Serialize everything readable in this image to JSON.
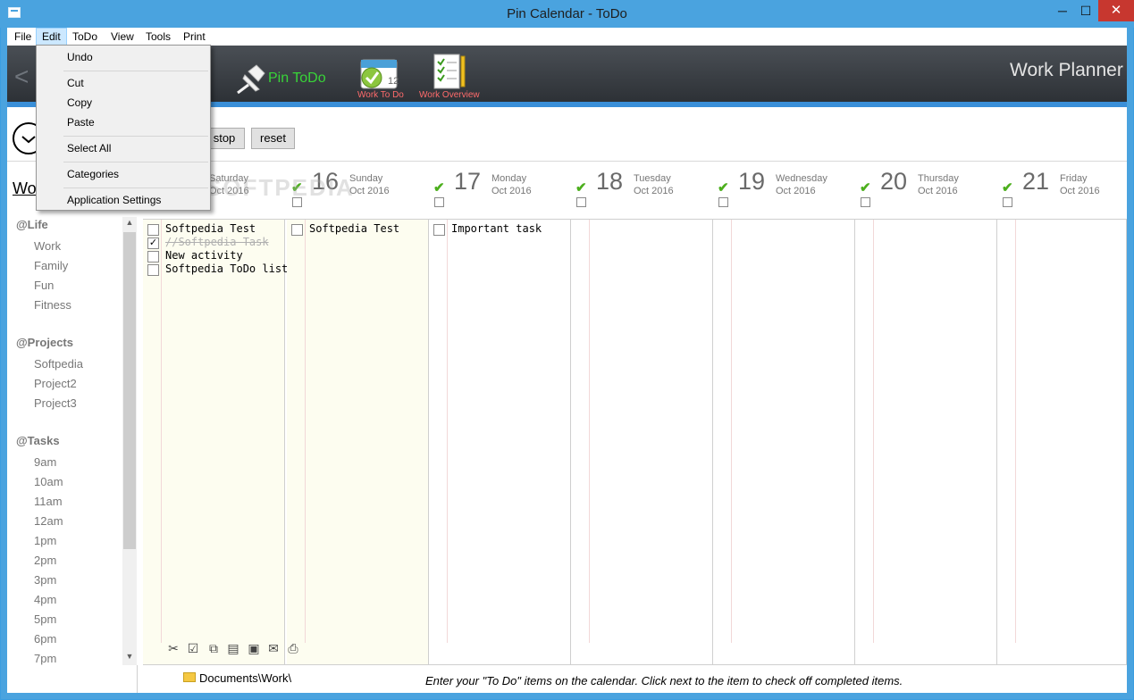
{
  "window": {
    "title": "Pin Calendar - ToDo",
    "minimize": "─",
    "maximize": "☐",
    "close": "✕"
  },
  "menubar": [
    "File",
    "Edit",
    "ToDo",
    "View",
    "Tools",
    "Print"
  ],
  "edit_menu": {
    "undo": "Undo",
    "cut": "Cut",
    "copy": "Copy",
    "paste": "Paste",
    "select_all": "Select All",
    "categories": "Categories",
    "application_settings": "Application Settings"
  },
  "toolbar": {
    "prev": "<",
    "pin_todo": "Pin ToDo",
    "work_todo": "Work To Do",
    "work_overview": "Work Overview",
    "planner_title": "Work Planner",
    "accent_color": "#3a8fd8"
  },
  "timer": {
    "stop": "stop",
    "reset": "reset"
  },
  "sidebar": {
    "title": "Wo",
    "groups": [
      {
        "head": "@Life",
        "items": [
          "Work",
          "Family",
          "Fun",
          "Fitness"
        ]
      },
      {
        "head": "@Projects",
        "items": [
          "Softpedia",
          "Project2",
          "Project3"
        ]
      },
      {
        "head": "@Tasks",
        "items": [
          "9am",
          "10am",
          "11am",
          "12am",
          "1pm",
          "2pm",
          "3pm",
          "4pm",
          "5pm",
          "6pm",
          "7pm"
        ]
      }
    ]
  },
  "calendar": {
    "days": [
      {
        "num": "",
        "name": "Saturday",
        "month": "Oct 2016",
        "tasks": [
          {
            "text": "Softpedia Test",
            "done": false
          },
          {
            "text": "//Softpedia Task",
            "done": true
          },
          {
            "text": "New activity",
            "done": false
          },
          {
            "text": "Softpedia ToDo list",
            "done": false
          }
        ]
      },
      {
        "num": "16",
        "name": "Sunday",
        "month": "Oct 2016",
        "tasks": [
          {
            "text": "Softpedia Test",
            "done": false
          }
        ]
      },
      {
        "num": "17",
        "name": "Monday",
        "month": "Oct 2016",
        "tasks": [
          {
            "text": "Important task",
            "done": false
          }
        ]
      },
      {
        "num": "18",
        "name": "Tuesday",
        "month": "Oct 2016",
        "tasks": []
      },
      {
        "num": "19",
        "name": "Wednesday",
        "month": "Oct 2016",
        "tasks": []
      },
      {
        "num": "20",
        "name": "Thursday",
        "month": "Oct 2016",
        "tasks": []
      },
      {
        "num": "21",
        "name": "Friday",
        "month": "Oct 2016",
        "tasks": []
      }
    ]
  },
  "status": {
    "path": "Documents\\Work\\",
    "hint": "Enter your \"To Do\" items on the calendar. Click next to the item to check off completed items."
  },
  "watermark": "SOFTPEDIA"
}
